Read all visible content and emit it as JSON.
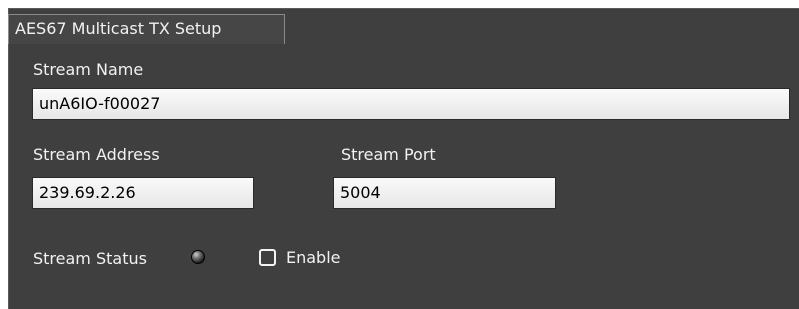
{
  "window": {
    "tab_title": "AES67 Multicast TX Setup"
  },
  "stream": {
    "name_label": "Stream Name",
    "name_value": "unA6IO-f00027",
    "address_label": "Stream Address",
    "address_value": "239.69.2.26",
    "port_label": "Stream Port",
    "port_value": "5004",
    "status_label": "Stream Status",
    "status_led": "off",
    "enable_label": "Enable",
    "enable_checked": false
  }
}
